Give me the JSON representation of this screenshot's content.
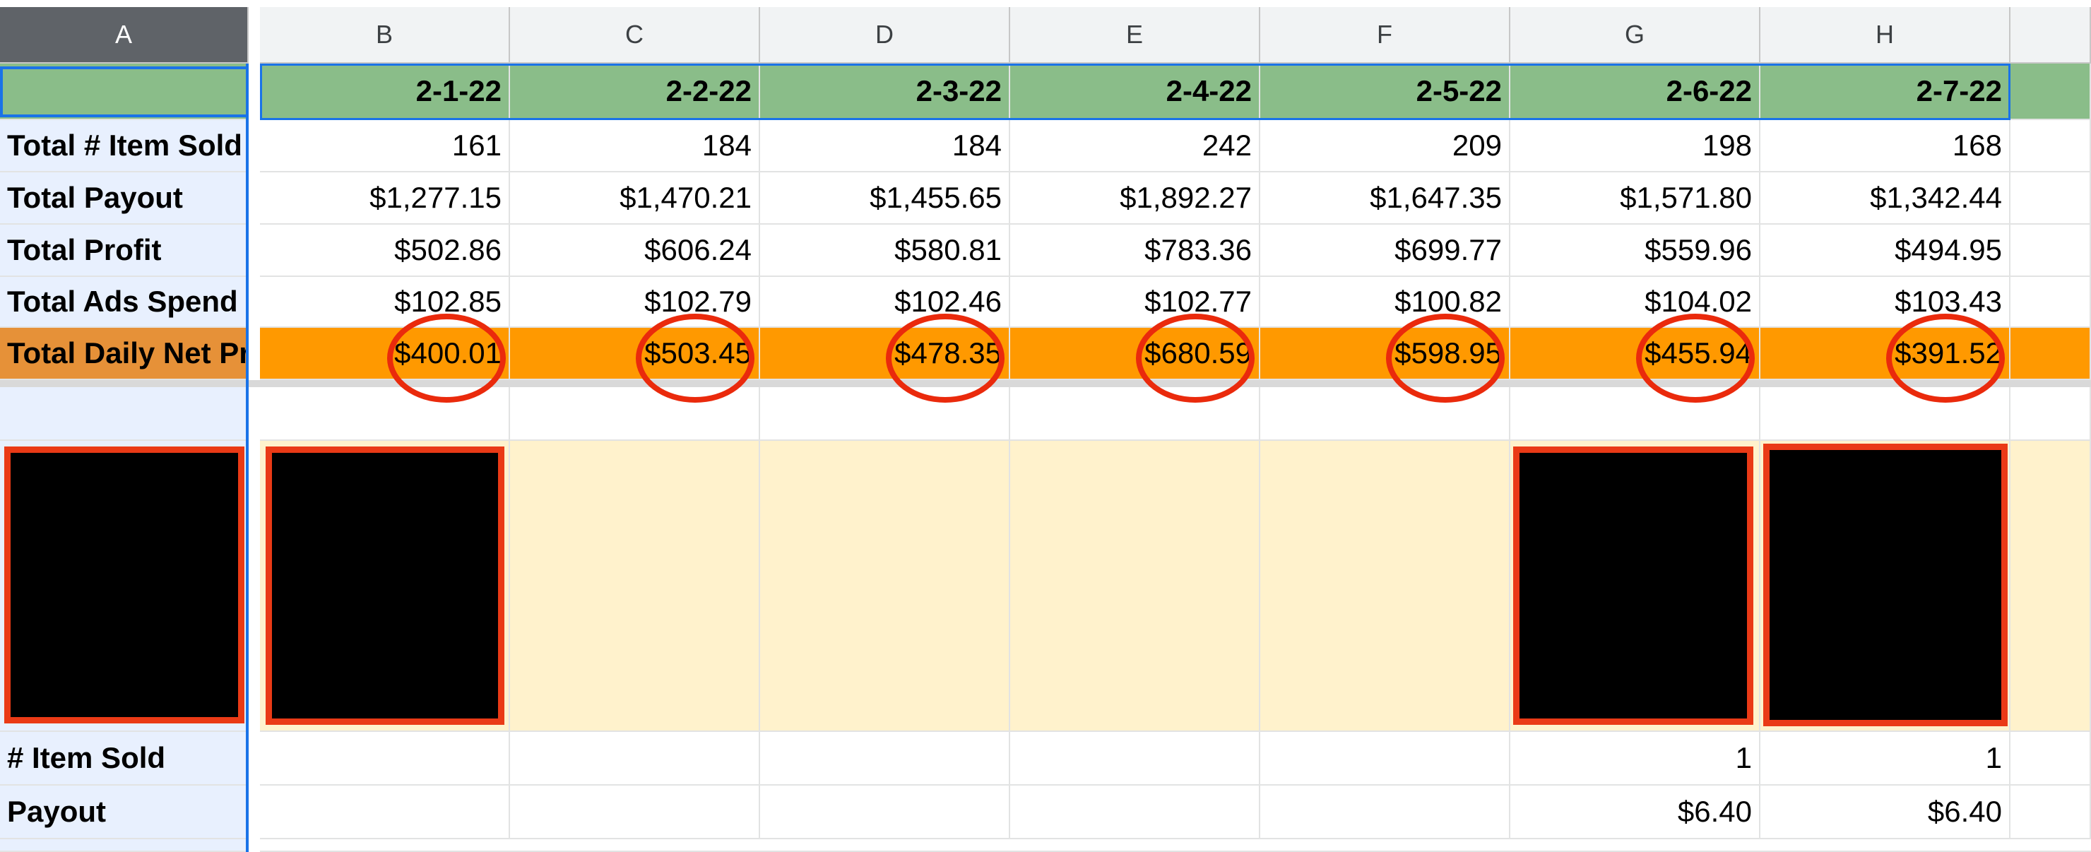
{
  "column_headers": [
    "A",
    "B",
    "C",
    "D",
    "E",
    "F",
    "G",
    "H"
  ],
  "dates": [
    "2-1-22",
    "2-2-22",
    "2-3-22",
    "2-4-22",
    "2-5-22",
    "2-6-22",
    "2-7-22"
  ],
  "rows": [
    {
      "label": "Total # Item Sold",
      "values": [
        "161",
        "184",
        "184",
        "242",
        "209",
        "198",
        "168"
      ]
    },
    {
      "label": "Total Payout",
      "values": [
        "$1,277.15",
        "$1,470.21",
        "$1,455.65",
        "$1,892.27",
        "$1,647.35",
        "$1,571.80",
        "$1,342.44"
      ]
    },
    {
      "label": "Total Profit",
      "values": [
        "$502.86",
        "$606.24",
        "$580.81",
        "$783.36",
        "$699.77",
        "$559.96",
        "$494.95"
      ]
    },
    {
      "label": "Total Ads Spend",
      "values": [
        "$102.85",
        "$102.79",
        "$102.46",
        "$102.77",
        "$100.82",
        "$104.02",
        "$103.43"
      ]
    },
    {
      "label": "Total Daily Net Profit",
      "values": [
        "$400.01",
        "$503.45",
        "$478.35",
        "$680.59",
        "$598.95",
        "$455.94",
        "$391.52"
      ]
    }
  ],
  "bottom_rows": [
    {
      "label": "# Item Sold",
      "values": [
        "",
        "",
        "",
        "",
        "",
        "1",
        "1"
      ]
    },
    {
      "label": "Payout",
      "values": [
        "",
        "",
        "",
        "",
        "",
        "$6.40",
        "$6.40"
      ]
    }
  ],
  "colors": {
    "header_green": "#8abd89",
    "highlight_orange": "#ff9900",
    "label_orange": "#e69138",
    "image_row_cream": "#fff2cc",
    "annotation_red": "#ea2a0c"
  }
}
